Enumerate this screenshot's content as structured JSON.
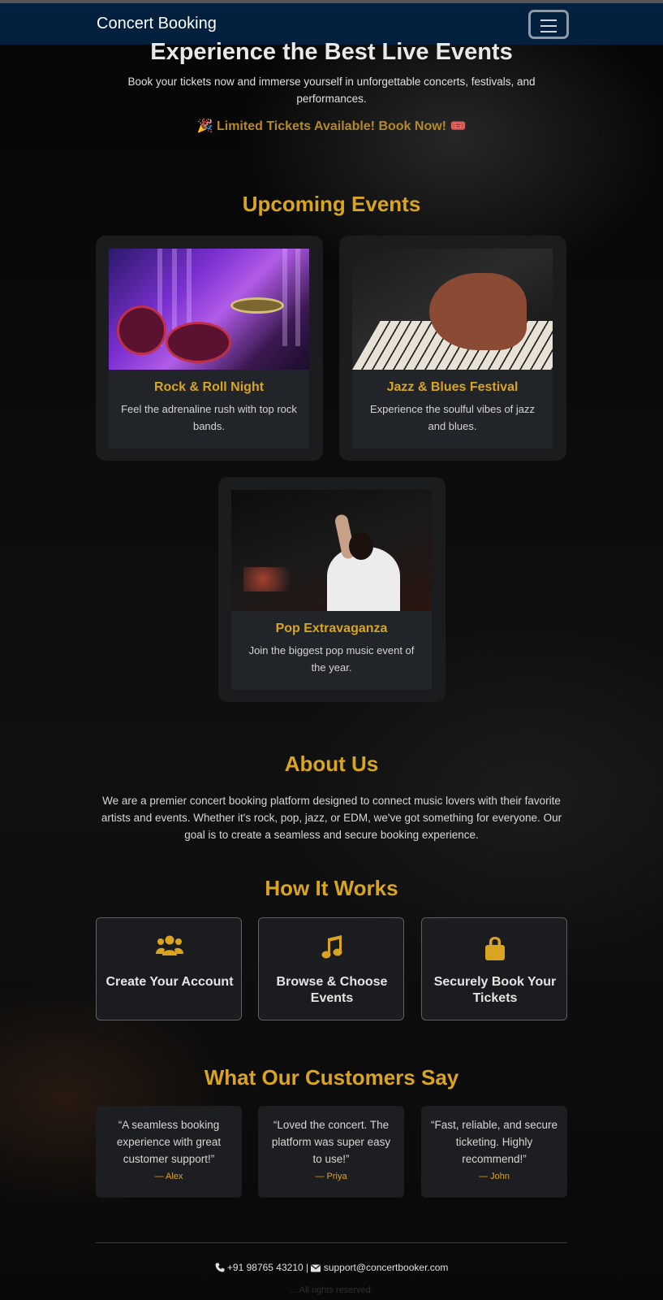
{
  "navbar": {
    "brand": "Concert Booking",
    "toggler_icon": "hamburger-icon"
  },
  "hero": {
    "title": "Experience the Best Live Events",
    "subtitle": "Book your tickets now and immerse yourself in unforgettable concerts, festivals, and performances.",
    "promo": "🎉 Limited Tickets Available! Book Now! 🎟️"
  },
  "events": {
    "heading": "Upcoming Events",
    "items": [
      {
        "title": "Rock & Roll Night",
        "description": "Feel the adrenaline rush with top rock bands."
      },
      {
        "title": "Jazz & Blues Festival",
        "description": "Experience the soulful vibes of jazz and blues."
      },
      {
        "title": "Pop Extravaganza",
        "description": "Join the biggest pop music event of the year."
      }
    ]
  },
  "about": {
    "heading": "About Us",
    "text": "We are a premier concert booking platform designed to connect music lovers with their favorite artists and events. Whether it's rock, pop, jazz, or EDM, we've got something for everyone. Our goal is to create a seamless and secure booking experience."
  },
  "how_it_works": {
    "heading": "How It Works",
    "steps": [
      {
        "label": "Create Your Account",
        "icon": "users-icon"
      },
      {
        "label": "Browse & Choose Events",
        "icon": "music-note-icon"
      },
      {
        "label": "Securely Book Your Tickets",
        "icon": "lock-icon"
      }
    ]
  },
  "testimonials": {
    "heading": "What Our Customers Say",
    "items": [
      {
        "quote": "“A seamless booking experience with great customer support!”",
        "author": "— Alex"
      },
      {
        "quote": "“Loved the concert. The platform was super easy to use!”",
        "author": "— Priya"
      },
      {
        "quote": "“Fast, reliable, and secure ticketing. Highly recommend!”",
        "author": "— John"
      }
    ]
  },
  "footer": {
    "phone": "+91 98765 43210",
    "separator": "|",
    "email": "support@concertbooker.com",
    "copyright": "... All rights reserved."
  },
  "colors": {
    "accent": "#d9a521",
    "navbar": "#03203f",
    "card": "#1b1c1e"
  }
}
